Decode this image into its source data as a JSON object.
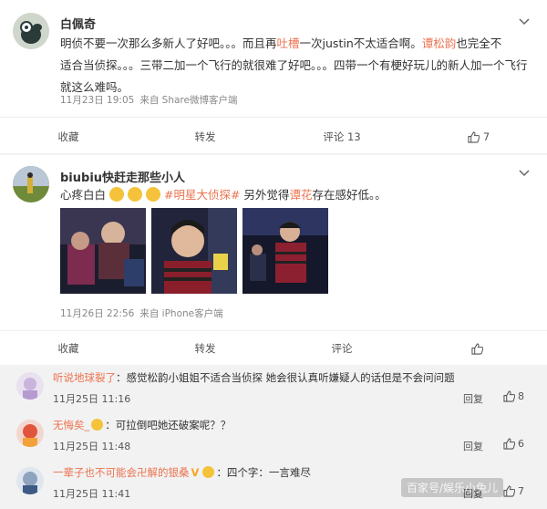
{
  "post1": {
    "username": "白佩奇",
    "text_a": "明侦不要一次那么多新人了好吧。。。而且再",
    "text_hl1": "吐槽",
    "text_b": "一次justin不太适合啊。",
    "text_hl2": "谭松韵",
    "text_c": "也完全不",
    "line2": "适合当侦探。。。三带二加一个飞行的就很难了好吧。。。四带一个有梗好玩儿的新人加一个飞行",
    "line3": "就这么难吗。",
    "time": "11月23日 19:05",
    "source": "来自 Share微博客户端",
    "actions": {
      "favorite": "收藏",
      "repost": "转发",
      "comment": "评论 13",
      "like": "7"
    }
  },
  "post2": {
    "username": "biubiu快赶走那些小人",
    "text_a": "心疼白白",
    "text_tag": "#明星大侦探#",
    "text_b": "另外觉得",
    "text_hl": "谭花",
    "text_c": "存在感好低。。",
    "time": "11月26日 22:56",
    "source": "来自 iPhone客户端",
    "actions": {
      "favorite": "收藏",
      "repost": "转发",
      "comment": "评论",
      "like": ""
    }
  },
  "comments": [
    {
      "name": "听说地球裂了",
      "text": "：感觉松韵小姐姐不适合当侦探  她会很认真听嫌疑人的话但是不会问问题",
      "time": "11月25日 11:16",
      "reply": "回复",
      "likes": "8"
    },
    {
      "name": "无悔矣_",
      "text": "：可拉倒吧她还破案呢？？",
      "time": "11月25日 11:48",
      "reply": "回复",
      "likes": "6"
    },
    {
      "name": "一辈子也不可能会卍解的银桑",
      "text": "：四个字：一言难尽",
      "time": "11月25日 11:41",
      "reply": "回复",
      "likes": "7"
    }
  ],
  "watermark": "百家号/娱乐小兔儿",
  "colors": {
    "accent": "#eb7350",
    "text": "#333333",
    "meta": "#888888"
  },
  "icons": {
    "chevron": "chevron-down-icon",
    "like": "thumbs-up-icon"
  }
}
